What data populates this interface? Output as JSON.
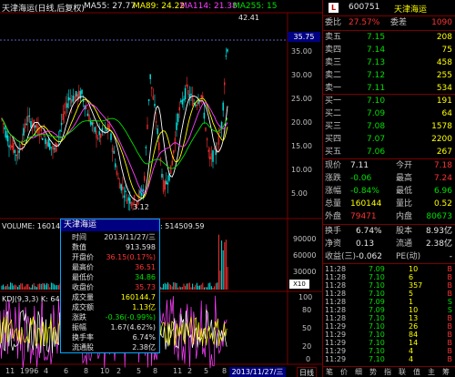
{
  "chart_header": {
    "title": "天津海运(日线,后复权)",
    "ma55": "MA55: 27.77",
    "ma89": "MA89: 24.22",
    "ma114": "MA114: 21.38",
    "ma255": "MA255: 15",
    "price_high_label": "42.41",
    "price_low_label": "3.12",
    "axis_current": "35.75",
    "axis_ticks": [
      "35.00",
      "30.00",
      "25.00",
      "20.00",
      "15.00",
      "10.00",
      "5.00"
    ]
  },
  "volume_panel": {
    "label": "VOLUME: 16014",
    "value2": ": 514509.59",
    "ticks": [
      "90000",
      "60000",
      "30000"
    ],
    "unit": "X10"
  },
  "kdj_panel": {
    "label": "KDJ(9,3,3) K: 64",
    "ticks": [
      "100",
      "80",
      "50",
      "20",
      "0"
    ]
  },
  "x_axis": {
    "labels": [
      "11",
      "1996",
      "4",
      "6",
      "8",
      "10",
      "2",
      "5",
      "8",
      "11",
      "2",
      "5",
      "8",
      "11",
      "2",
      "5",
      "8",
      "11",
      "2"
    ],
    "date_box": "2013/11/27/三",
    "tab": "日线"
  },
  "quote": {
    "code": "600751",
    "name": "天津海运",
    "wei_bi_label": "委比",
    "wei_bi": "27.57%",
    "wei_cha_label": "委差",
    "wei_cha": "1090",
    "sell": [
      {
        "label": "卖五",
        "price": "7.15",
        "vol": "208"
      },
      {
        "label": "卖四",
        "price": "7.14",
        "vol": "75"
      },
      {
        "label": "卖三",
        "price": "7.13",
        "vol": "458"
      },
      {
        "label": "卖二",
        "price": "7.12",
        "vol": "255"
      },
      {
        "label": "卖一",
        "price": "7.11",
        "vol": "534"
      }
    ],
    "buy": [
      {
        "label": "买一",
        "price": "7.10",
        "vol": "191"
      },
      {
        "label": "买二",
        "price": "7.09",
        "vol": "64"
      },
      {
        "label": "买三",
        "price": "7.08",
        "vol": "1578"
      },
      {
        "label": "买四",
        "price": "7.07",
        "vol": "2200"
      },
      {
        "label": "买五",
        "price": "7.06",
        "vol": "267"
      }
    ],
    "stats": [
      {
        "k1": "现价",
        "v1": "7.11",
        "k2": "今开",
        "v2": "7.18"
      },
      {
        "k1": "涨跌",
        "v1": "-0.06",
        "k2": "最高",
        "v2": "7.24"
      },
      {
        "k1": "涨幅",
        "v1": "-0.84%",
        "k2": "最低",
        "v2": "6.96"
      },
      {
        "k1": "总量",
        "v1": "160144",
        "k2": "量比",
        "v2": "0.52"
      },
      {
        "k1": "外盘",
        "v1": "79471",
        "k2": "内盘",
        "v2": "80673"
      }
    ],
    "stats2": [
      {
        "k1": "换手",
        "v1": "6.74%",
        "k2": "股本",
        "v2": "8.93亿"
      },
      {
        "k1": "净资",
        "v1": "0.13",
        "k2": "流通",
        "v2": "2.38亿"
      },
      {
        "k1": "收益(三)",
        "v1": "-0.062",
        "k2": "PE(动)",
        "v2": "-"
      }
    ],
    "ticks": [
      {
        "time": "11:28",
        "price": "7.09",
        "vol": "10",
        "side": "B"
      },
      {
        "time": "11:28",
        "price": "7.10",
        "vol": "6",
        "side": "B"
      },
      {
        "time": "11:28",
        "price": "7.10",
        "vol": "357",
        "side": "B"
      },
      {
        "time": "11:28",
        "price": "7.10",
        "vol": "5",
        "side": "B"
      },
      {
        "time": "11:28",
        "price": "7.09",
        "vol": "1",
        "side": "S"
      },
      {
        "time": "11:28",
        "price": "7.09",
        "vol": "10",
        "side": "S"
      },
      {
        "time": "11:28",
        "price": "7.10",
        "vol": "13",
        "side": "B"
      },
      {
        "time": "11:29",
        "price": "7.10",
        "vol": "26",
        "side": "B"
      },
      {
        "time": "11:29",
        "price": "7.10",
        "vol": "84",
        "side": "B"
      },
      {
        "time": "11:29",
        "price": "7.10",
        "vol": "14",
        "side": "B"
      },
      {
        "time": "11:29",
        "price": "7.10",
        "vol": "4",
        "side": "B"
      },
      {
        "time": "11:29",
        "price": "7.10",
        "vol": "4",
        "side": "B"
      }
    ],
    "footer": [
      "笔",
      "价",
      "细",
      "势",
      "指",
      "联",
      "值",
      "主",
      "筹"
    ]
  },
  "popup": {
    "title": "天津海运",
    "rows": [
      {
        "k": "时间",
        "v": "2013/11/27/三"
      },
      {
        "k": "数值",
        "v": "913.598"
      },
      {
        "k": "开盘价",
        "v": "36.15(0.17%)"
      },
      {
        "k": "最高价",
        "v": "36.51"
      },
      {
        "k": "最低价",
        "v": "34.86"
      },
      {
        "k": "收盘价",
        "v": "35.73"
      },
      {
        "k": "成交量",
        "v": "160144.7"
      },
      {
        "k": "成交额",
        "v": "1.13亿"
      },
      {
        "k": "涨跌",
        "v": "-0.36(-0.99%)"
      },
      {
        "k": "振幅",
        "v": "1.67(4.62%)"
      },
      {
        "k": "换手率",
        "v": "6.74%"
      },
      {
        "k": "流通股",
        "v": "2.38亿"
      }
    ]
  },
  "colors": {
    "up": "#ff3232",
    "down": "#00e0e0",
    "ma55": "#ffffff",
    "ma89": "#ffff00",
    "ma114": "#ff40ff",
    "ma255": "#00e000",
    "grid": "#7a0000"
  }
}
